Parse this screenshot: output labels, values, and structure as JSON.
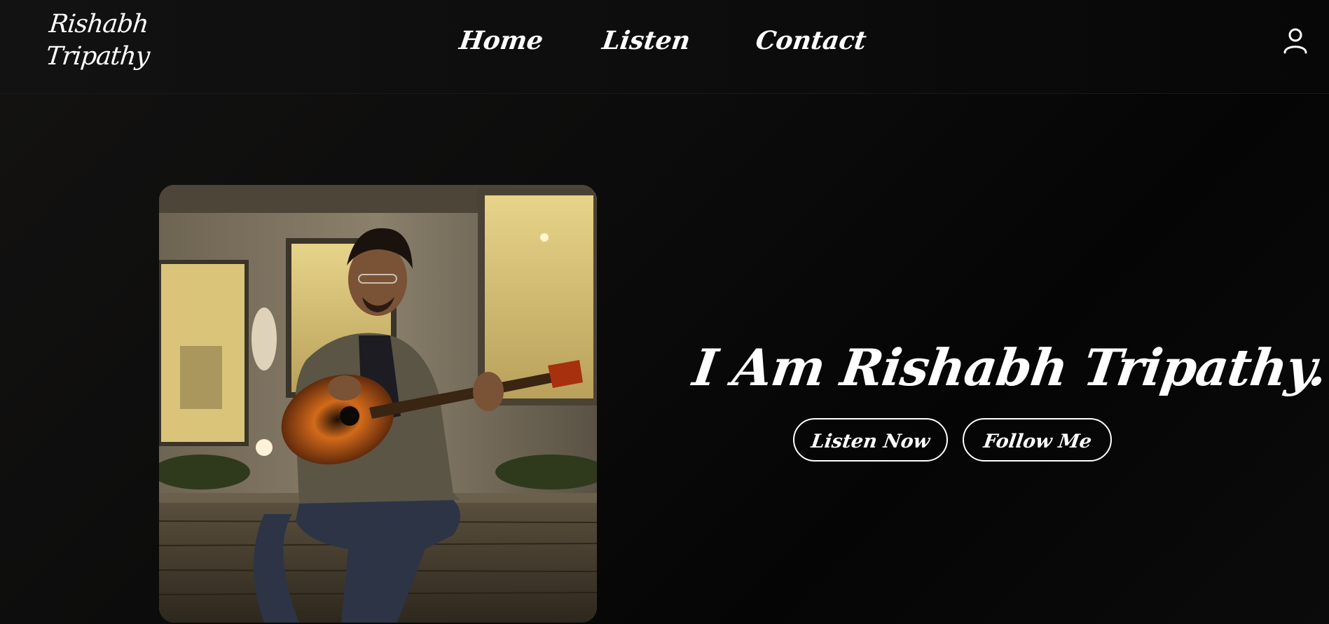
{
  "header": {
    "logo_text": "Rishabh Tripathy",
    "nav": {
      "home": "Home",
      "listen": "Listen",
      "contact": "Contact"
    },
    "account_icon": "user-icon"
  },
  "hero": {
    "image_alt_icon": "photo-guitarist",
    "title": "I Am Rishabh Tripathy.",
    "buttons": {
      "listen_now": "Listen Now",
      "follow_me": "Follow Me"
    }
  },
  "colors": {
    "background": "#0a0a0a",
    "text": "#ffffff",
    "header_border": "#16162a"
  }
}
